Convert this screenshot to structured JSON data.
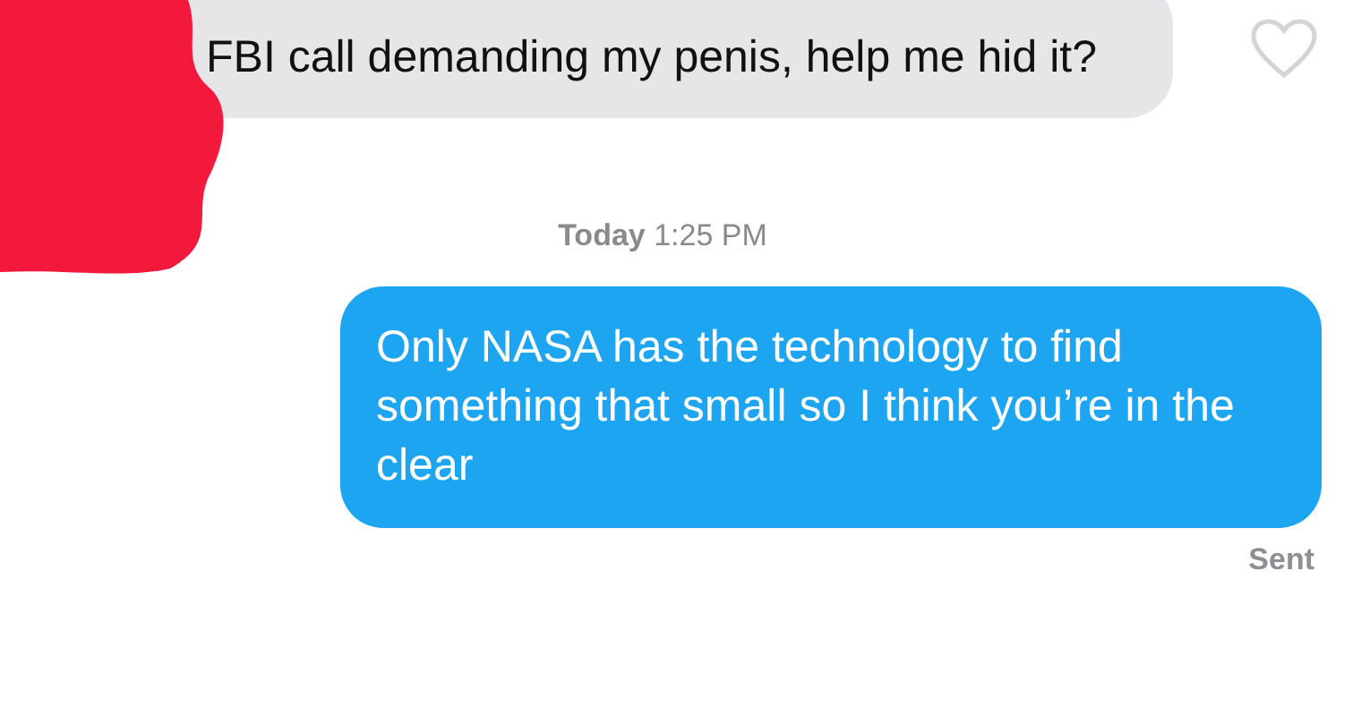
{
  "messages": [
    {
      "kind": "incoming",
      "text": "FBI call demanding my penis, help me hid it?",
      "liked": false
    },
    {
      "kind": "timestamp",
      "text": "**Today** 1:25 PM"
    },
    {
      "kind": "outgoing",
      "text": "Only NASA has the technology to find something that small so I think you’re in the clear",
      "status": "Sent"
    }
  ]
}
